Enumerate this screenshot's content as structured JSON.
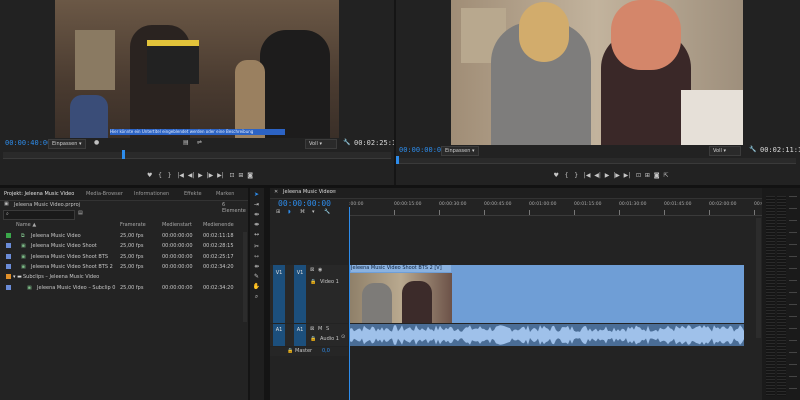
{
  "source_monitor": {
    "timecode_left": "00:00:40:00",
    "timecode_right": "00:02:25:18",
    "fit_label": "Einpassen",
    "quality_label": "Voll",
    "caption": "Hier könnte ein Untertitel eingeblendet werden oder eine Beschreibung"
  },
  "program_monitor": {
    "timecode_left": "00:00:00:00",
    "timecode_right": "00:02:11:19",
    "fit_label": "Einpassen",
    "quality_label": "Voll"
  },
  "project_panel": {
    "tabs": [
      "Projekt: Jeleena Music Video",
      "Media-Browser",
      "Informationen",
      "Effekte",
      "Marken"
    ],
    "project_file": "Jeleena Music Video.prproj",
    "item_count": "6 Elemente",
    "columns": [
      "Name",
      "Framerate",
      "Medienstart",
      "Medienende"
    ],
    "rows": [
      {
        "name": "Jeleena Music Video",
        "framerate": "25,00 fps",
        "start": "00:00:00:00",
        "end": "00:02:11:18",
        "color": "#3aa84a"
      },
      {
        "name": "Jeleena Music Video Shoot",
        "framerate": "25,00 fps",
        "start": "00:00:00:00",
        "end": "00:02:28:15",
        "color": "#6a8cd8"
      },
      {
        "name": "Jeleena Music Video Shoot BTS",
        "framerate": "25,00 fps",
        "start": "00:00:00:00",
        "end": "00:02:25:17",
        "color": "#6a8cd8"
      },
      {
        "name": "Jeleena Music Video Shoot BTS 2",
        "framerate": "25,00 fps",
        "start": "00:00:00:00",
        "end": "00:02:34:20",
        "color": "#6a8cd8"
      },
      {
        "name": "Subclips – Jeleena Music Video",
        "framerate": "",
        "start": "",
        "end": "",
        "color": "#e0902a"
      },
      {
        "name": "Jeleena Music Video – Subclip 0",
        "framerate": "25,00 fps",
        "start": "00:00:00:00",
        "end": "00:02:34:20",
        "color": "#6a8cd8"
      }
    ]
  },
  "timeline": {
    "tab_title": "Jeleena Music Video",
    "timecode": "00:00:00:00",
    "ruler": [
      ":00:00",
      "00:00:15:00",
      "00:00:30:00",
      "00:00:45:00",
      "00:01:00:00",
      "00:01:15:00",
      "00:01:30:00",
      "00:01:45:00",
      "00:02:00:00",
      "00:02:15:00"
    ],
    "video_track": {
      "source": "V1",
      "target": "V1",
      "label": "Video 1"
    },
    "audio_track": {
      "source": "A1",
      "target": "A1",
      "label": "Audio 1",
      "m": "M",
      "s": "S"
    },
    "master": {
      "label": "Master",
      "value": "0,0"
    },
    "clip_label": "Jeleena Music Video Shoot BTS 2 [V]"
  },
  "colors": {
    "accent": "#2d8ceb",
    "clip_video": "#6f9ed6",
    "clip_audio": "#4a6d96",
    "panel": "#232323"
  }
}
